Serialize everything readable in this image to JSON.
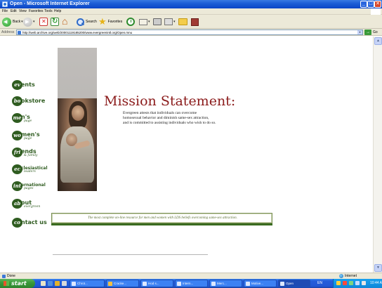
{
  "window": {
    "title": "Open - Microsoft Internet Explorer",
    "minimize": "_",
    "maximize": "□",
    "close": "✕"
  },
  "menu": [
    "File",
    "Edit",
    "View",
    "Favorites",
    "Tools",
    "Help"
  ],
  "toolbar": {
    "back_label": "Back",
    "search_label": "Search",
    "favorites_label": "Favorites",
    "caret": "▾"
  },
  "address": {
    "label": "Address",
    "url": "http://web.archive.org/web/20001119185200/www.evergreenintl.org/Open.mnu",
    "dropdown": "▾",
    "go": "→",
    "go_label": "Go"
  },
  "nav": [
    {
      "bubble": "ev",
      "text": "ents",
      "sub": ""
    },
    {
      "bubble": "bo",
      "text": "okstore",
      "sub": ""
    },
    {
      "bubble": "me",
      "text": "n's",
      "sub": "page"
    },
    {
      "bubble": "wo",
      "text": "men's",
      "sub": "page"
    },
    {
      "bubble": "fri",
      "text": "ends",
      "sub": "& family"
    },
    {
      "bubble": "ec",
      "text": "clesiastical",
      "sub": "leaders"
    },
    {
      "bubble": "int",
      "text": "ernational",
      "sub": "pages"
    },
    {
      "bubble": "ab",
      "text": "out",
      "sub": "evergreen"
    },
    {
      "bubble": "co",
      "text": "ntact us",
      "sub": ""
    }
  ],
  "mission": {
    "title": "Mission Statement:",
    "lines": [
      "Evergreen attests that individuals can overcome",
      "homosexual behavior and diminish same-sex attraction,",
      "and is committed to assisting individuals who wish to do so."
    ]
  },
  "tagline": "The most complete on-line resource for men and women with LDS beliefs overcoming same-sex attraction.",
  "status": {
    "text": "Done",
    "zone": "Internet"
  },
  "taskbar": {
    "start": "start",
    "tasks": [
      "Chrot...",
      "Cracke...",
      "Hod s...",
      "Intern...",
      "Merc...",
      "Motive...",
      "Open",
      "EN"
    ],
    "clock": "10:44 AM"
  },
  "scroll": {
    "up": "▲",
    "down": "▼"
  }
}
